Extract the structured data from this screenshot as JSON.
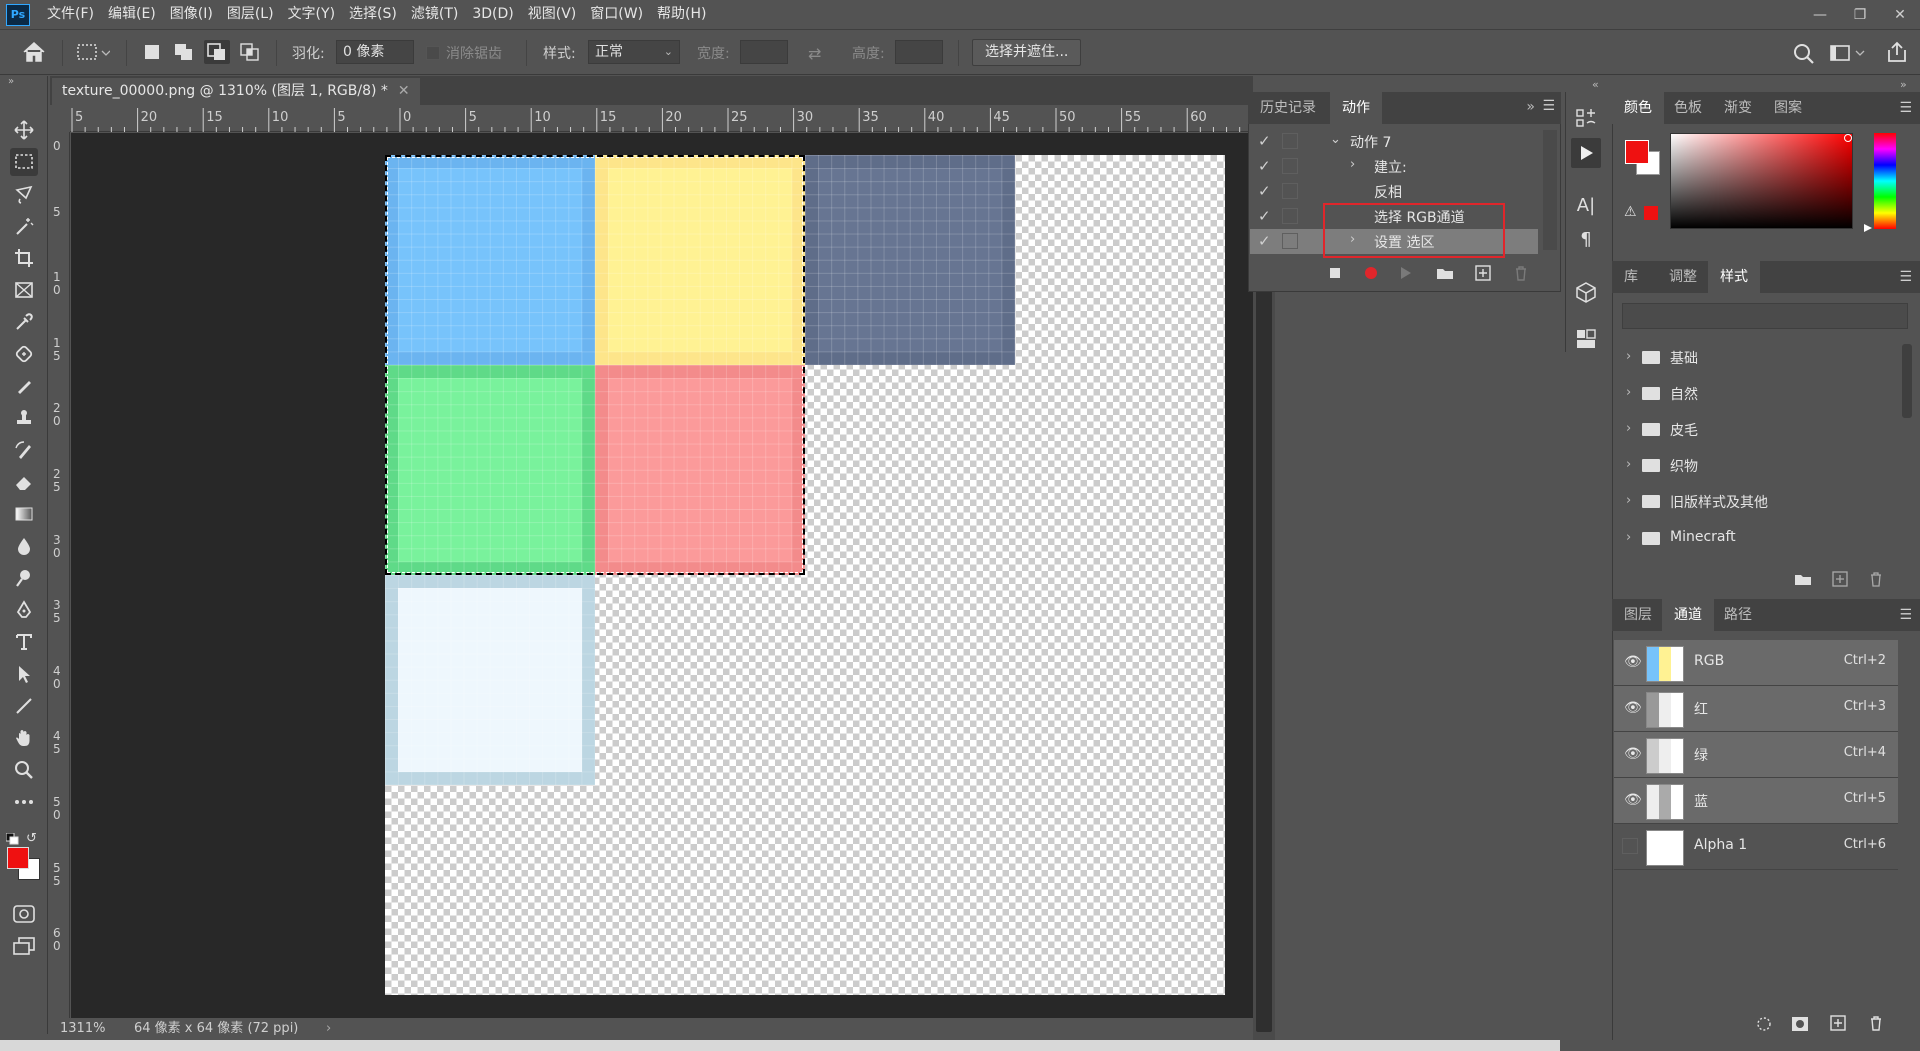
{
  "menubar": {
    "items": [
      "文件(F)",
      "编辑(E)",
      "图像(I)",
      "图层(L)",
      "文字(Y)",
      "选择(S)",
      "滤镜(T)",
      "3D(D)",
      "视图(V)",
      "窗口(W)",
      "帮助(H)"
    ],
    "logo": "Ps"
  },
  "options": {
    "feather_label": "羽化:",
    "feather_value": "0 像素",
    "antialias_label": "消除锯齿",
    "style_label": "样式:",
    "style_value": "正常",
    "width_label": "宽度:",
    "height_label": "高度:",
    "select_mask_button": "选择并遮住..."
  },
  "document": {
    "tab_title": "texture_00000.png @ 1310% (图层 1, RGB/8) *",
    "zoom": "1311%",
    "size_info": "64 像素 x 64 像素 (72 ppi)"
  },
  "rulers": {
    "horizontal": [
      "5",
      "20",
      "15",
      "10",
      "5",
      "0",
      "5",
      "10",
      "15",
      "20",
      "25",
      "30",
      "35",
      "40",
      "45",
      "50",
      "55",
      "60",
      "6"
    ],
    "vertical": [
      "0",
      "5",
      "1\n0",
      "1\n5",
      "2\n0",
      "2\n5",
      "3\n0",
      "3\n5",
      "4\n0",
      "4\n5",
      "5\n0",
      "5\n5",
      "6\n0"
    ]
  },
  "actions_panel": {
    "tabs": [
      "历史记录",
      "动作"
    ],
    "rows": [
      {
        "label": "动作 7",
        "level": 1,
        "expand": "open"
      },
      {
        "label": "建立:",
        "level": 2,
        "expand": "closed"
      },
      {
        "label": "反相",
        "level": 2,
        "expand": "none"
      },
      {
        "label": "选择 RGB通道",
        "level": 2,
        "expand": "none"
      },
      {
        "label": "设置 选区",
        "level": 2,
        "expand": "closed"
      }
    ]
  },
  "color_panel": {
    "tabs": [
      "颜色",
      "色板",
      "渐变",
      "图案"
    ],
    "foreground": "#ef1111",
    "background": "#ffffff"
  },
  "styles_panel": {
    "tabs": [
      "库",
      "调整",
      "样式"
    ],
    "folders": [
      "基础",
      "自然",
      "皮毛",
      "织物",
      "旧版样式及其他",
      "Minecraft"
    ]
  },
  "channels_panel": {
    "tabs": [
      "图层",
      "通道",
      "路径"
    ],
    "channels": [
      {
        "name": "RGB",
        "shortcut": "Ctrl+2"
      },
      {
        "name": "红",
        "shortcut": "Ctrl+3"
      },
      {
        "name": "绿",
        "shortcut": "Ctrl+4"
      },
      {
        "name": "蓝",
        "shortcut": "Ctrl+5"
      },
      {
        "name": "Alpha 1",
        "shortcut": "Ctrl+6"
      }
    ]
  },
  "canvas_tiles": {
    "colors": {
      "blue_outer": "#6bb4f0",
      "blue_inner": "#77c3fb",
      "yellow_outer": "#fde58a",
      "yellow_inner": "#fff293",
      "slate_outer": "#5f6d89",
      "slate_inner": "#677592",
      "green_outer": "#5fda88",
      "green_inner": "#79f29c",
      "red_outer": "#f38b8b",
      "red_inner": "#fb9a9a",
      "white_outer": "#bcd6e2",
      "white_inner": "#eef7fd"
    }
  }
}
